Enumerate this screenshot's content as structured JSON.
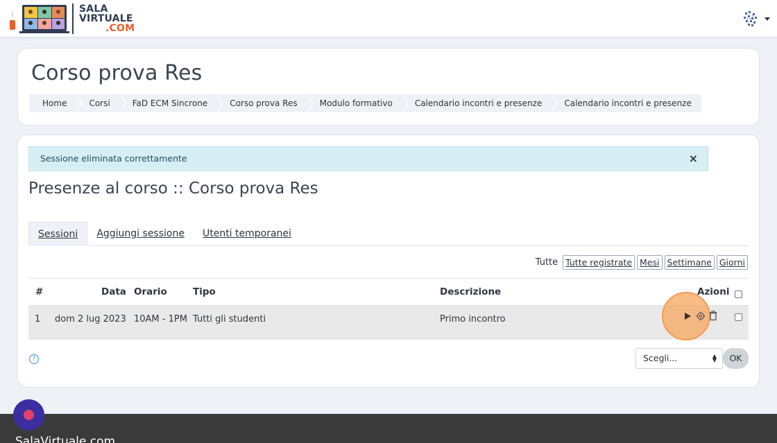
{
  "brand": {
    "line1": "SALA",
    "line2": "VIRTUALE",
    "line3": ".COM",
    "accent_color": "#e8602c",
    "text_color": "#2f3d55"
  },
  "header": {
    "title": "Corso prova Res",
    "breadcrumb": [
      "Home",
      "Corsi",
      "FaD ECM Sincrone",
      "Corso prova Res",
      "Modulo formativo",
      "Calendario incontri e presenze",
      "Calendario incontri e presenze"
    ]
  },
  "alert": {
    "message": "Sessione eliminata correttamente",
    "close_icon": "×"
  },
  "section": {
    "title": "Presenze al corso :: Corso prova Res"
  },
  "tabs": [
    {
      "label": "Sessioni",
      "active": true
    },
    {
      "label": "Aggiungi sessione",
      "active": false
    },
    {
      "label": "Utenti temporanei",
      "active": false
    }
  ],
  "filters": {
    "label": "Tutte",
    "buttons": [
      "Tutte registrate",
      "Mesi",
      "Settimane",
      "Giorni"
    ]
  },
  "table": {
    "headers": {
      "num": "#",
      "date": "Data",
      "time": "Orario",
      "type": "Tipo",
      "description": "Descrizione",
      "actions": "Azioni"
    },
    "rows": [
      {
        "num": "1",
        "date": "dom 2 lug 2023",
        "time": "10AM - 1PM",
        "type": "Tutti gli studenti",
        "description": "Primo incontro"
      }
    ]
  },
  "bulk": {
    "select_value": "Scegli...",
    "ok_label": "OK",
    "help_icon": "?"
  },
  "footer": {
    "text": "SalaVirtuale.com"
  }
}
